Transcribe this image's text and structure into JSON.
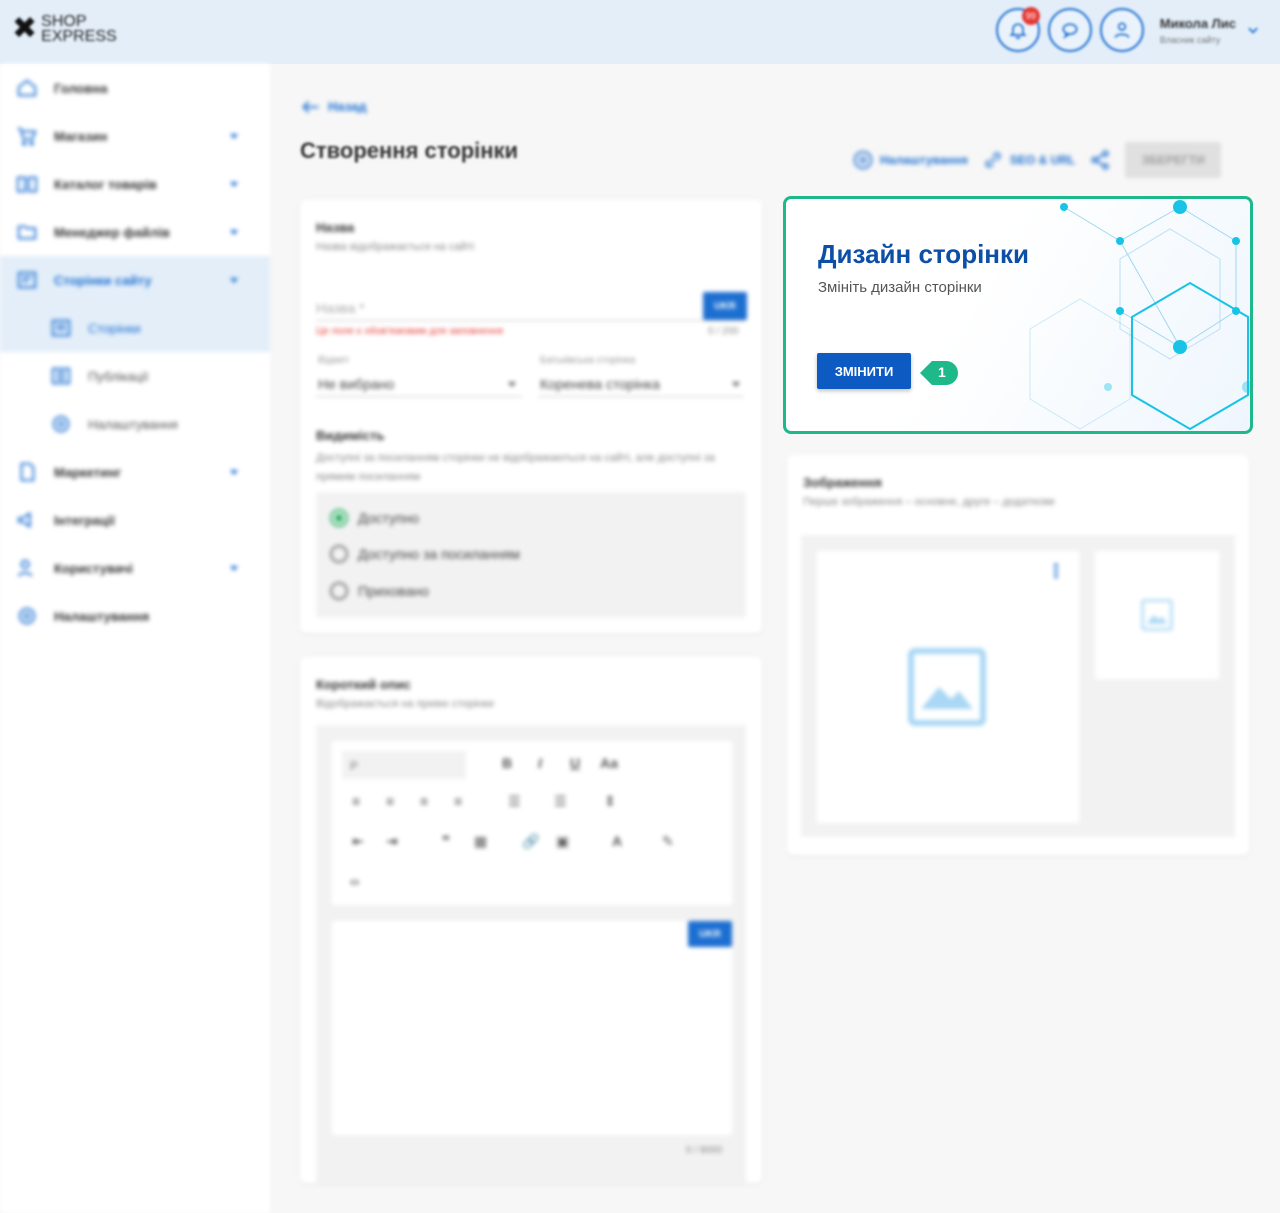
{
  "header": {
    "logo_top": "SHOP",
    "logo_bottom": "EXPRESS",
    "notification_count": "99",
    "user_name": "Микола Лис",
    "user_role": "Власник сайту"
  },
  "sidebar": {
    "items": [
      {
        "label": "Головна",
        "icon": "home-icon"
      },
      {
        "label": "Магазин",
        "icon": "cart-icon"
      },
      {
        "label": "Каталог товарів",
        "icon": "catalog-icon"
      },
      {
        "label": "Менеджер файлів",
        "icon": "folder-icon"
      },
      {
        "label": "Сторінки сайту",
        "icon": "pages-icon"
      },
      {
        "label": "Сторінки",
        "icon": "page-icon"
      },
      {
        "label": "Публікації",
        "icon": "publications-icon"
      },
      {
        "label": "Налаштування",
        "icon": "gear-icon"
      },
      {
        "label": "Маркетинг",
        "icon": "marketing-icon"
      },
      {
        "label": "Інтеграції",
        "icon": "megaphone-icon"
      },
      {
        "label": "Користувачі",
        "icon": "users-icon"
      },
      {
        "label": "Налаштування",
        "icon": "gear-icon"
      }
    ]
  },
  "main": {
    "back_label": "Назад",
    "title": "Створення сторінки",
    "toolbar": {
      "settings": "Налаштування",
      "seo": "SEO & URL",
      "save": "ЗБЕРЕГТИ"
    },
    "name_card": {
      "title": "Назва",
      "subtitle": "Назва відображається на сайті",
      "placeholder": "Назва *",
      "lang_button": "UKR",
      "error": "Це поле є обов'язковим для заповнення",
      "counter": "0 / 200",
      "view_label": "Відмет",
      "view_value": "Не вибрано",
      "parent_label": "Батьківська сторінка",
      "parent_value": "Коренева сторінка",
      "visibility_title": "Видимість",
      "visibility_subtitle": "Доступні за посиланням сторінки не відображаються на сайті, але доступні за прямим посиланням",
      "options": [
        "Доступно",
        "Доступно за посиланням",
        "Приховано"
      ],
      "selected_option": "Доступно"
    },
    "desc_card": {
      "title": "Короткий опис",
      "subtitle": "Відображається на превю сторінки",
      "format_value": "P",
      "lang_button": "UKR",
      "counter": "0 / 8000"
    },
    "design_card": {
      "title": "Дизайн сторінки",
      "subtitle": "Змініть дизайн сторінки",
      "button": "ЗМІНИТИ",
      "step": "1",
      "accent": "#1fb88a"
    },
    "images_card": {
      "title": "Зображення",
      "subtitle": "Перше зображення – основне, друге – додаткове"
    }
  },
  "colors": {
    "brand": "#1c6fd1",
    "header_bg": "#e3eef9",
    "design_title": "#0d4ea6"
  }
}
